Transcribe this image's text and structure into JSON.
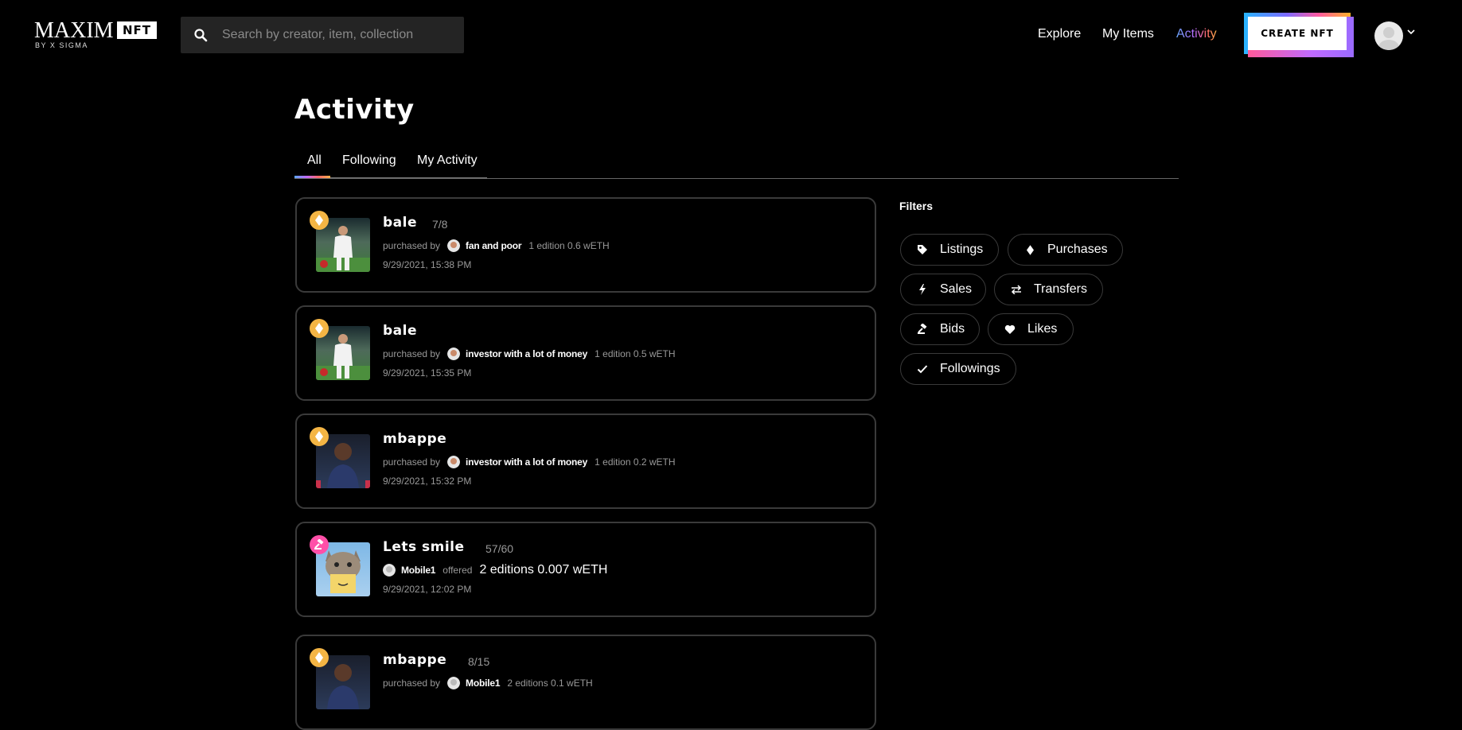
{
  "header": {
    "logo": {
      "main": "MAXIM",
      "badge": "NFT",
      "tagline": "BY X SIGMA"
    },
    "search": {
      "placeholder": "Search by creator, item, collection"
    },
    "nav": [
      {
        "label": "Explore"
      },
      {
        "label": "My Items"
      },
      {
        "label": "Activity",
        "active": true
      }
    ],
    "create_label": "CREATE NFT"
  },
  "page": {
    "title": "Activity",
    "tabs": [
      {
        "label": "All",
        "active": true
      },
      {
        "label": "Following"
      },
      {
        "label": "My Activity"
      }
    ]
  },
  "activities": [
    {
      "name": "bale",
      "count": "7/8",
      "action": "purchased by",
      "user": "fan and poor",
      "detail": "1 edition 0.6 wETH",
      "time": "9/29/2021, 15:38 PM",
      "type_icon": "diamond-icon",
      "thumb": "soccer-player-white-kit"
    },
    {
      "name": "bale",
      "count": "",
      "action": "purchased by",
      "user": "investor with a lot of money",
      "detail": "1 edition 0.5 wETH",
      "time": "9/29/2021, 15:35 PM",
      "type_icon": "diamond-icon",
      "thumb": "soccer-player-white-kit"
    },
    {
      "name": "mbappe",
      "count": "",
      "action": "purchased by",
      "user": "investor with a lot of money",
      "detail": "1 edition 0.2 wETH",
      "time": "9/29/2021, 15:32 PM",
      "type_icon": "diamond-icon",
      "thumb": "soccer-player-navy-kit"
    },
    {
      "name": "Lets smile",
      "count": "57/60",
      "action": "offered",
      "user": "Mobile1",
      "detail": "2 editions 0.007 wETH",
      "time": "9/29/2021, 12:02 PM",
      "type_icon": "gavel-icon",
      "thumb": "cat-with-sign"
    },
    {
      "name": "mbappe",
      "count": "8/15",
      "action": "purchased by",
      "user": "Mobile1",
      "detail": "2 editions 0.1 wETH",
      "time": "",
      "type_icon": "diamond-icon",
      "thumb": "soccer-player-navy-kit"
    }
  ],
  "filters": {
    "title": "Filters",
    "items": [
      {
        "label": "Listings",
        "icon": "tag-icon"
      },
      {
        "label": "Purchases",
        "icon": "diamond-icon"
      },
      {
        "label": "Sales",
        "icon": "lightning-icon"
      },
      {
        "label": "Transfers",
        "icon": "transfer-icon"
      },
      {
        "label": "Bids",
        "icon": "gavel-icon"
      },
      {
        "label": "Likes",
        "icon": "heart-icon"
      },
      {
        "label": "Followings",
        "icon": "check-icon"
      }
    ]
  },
  "colors": {
    "background": "#000000",
    "card_border": "#3a3a3a",
    "muted_text": "#999999",
    "purchase_badge": "#f4b544",
    "bid_badge": "#ff4fa8"
  }
}
